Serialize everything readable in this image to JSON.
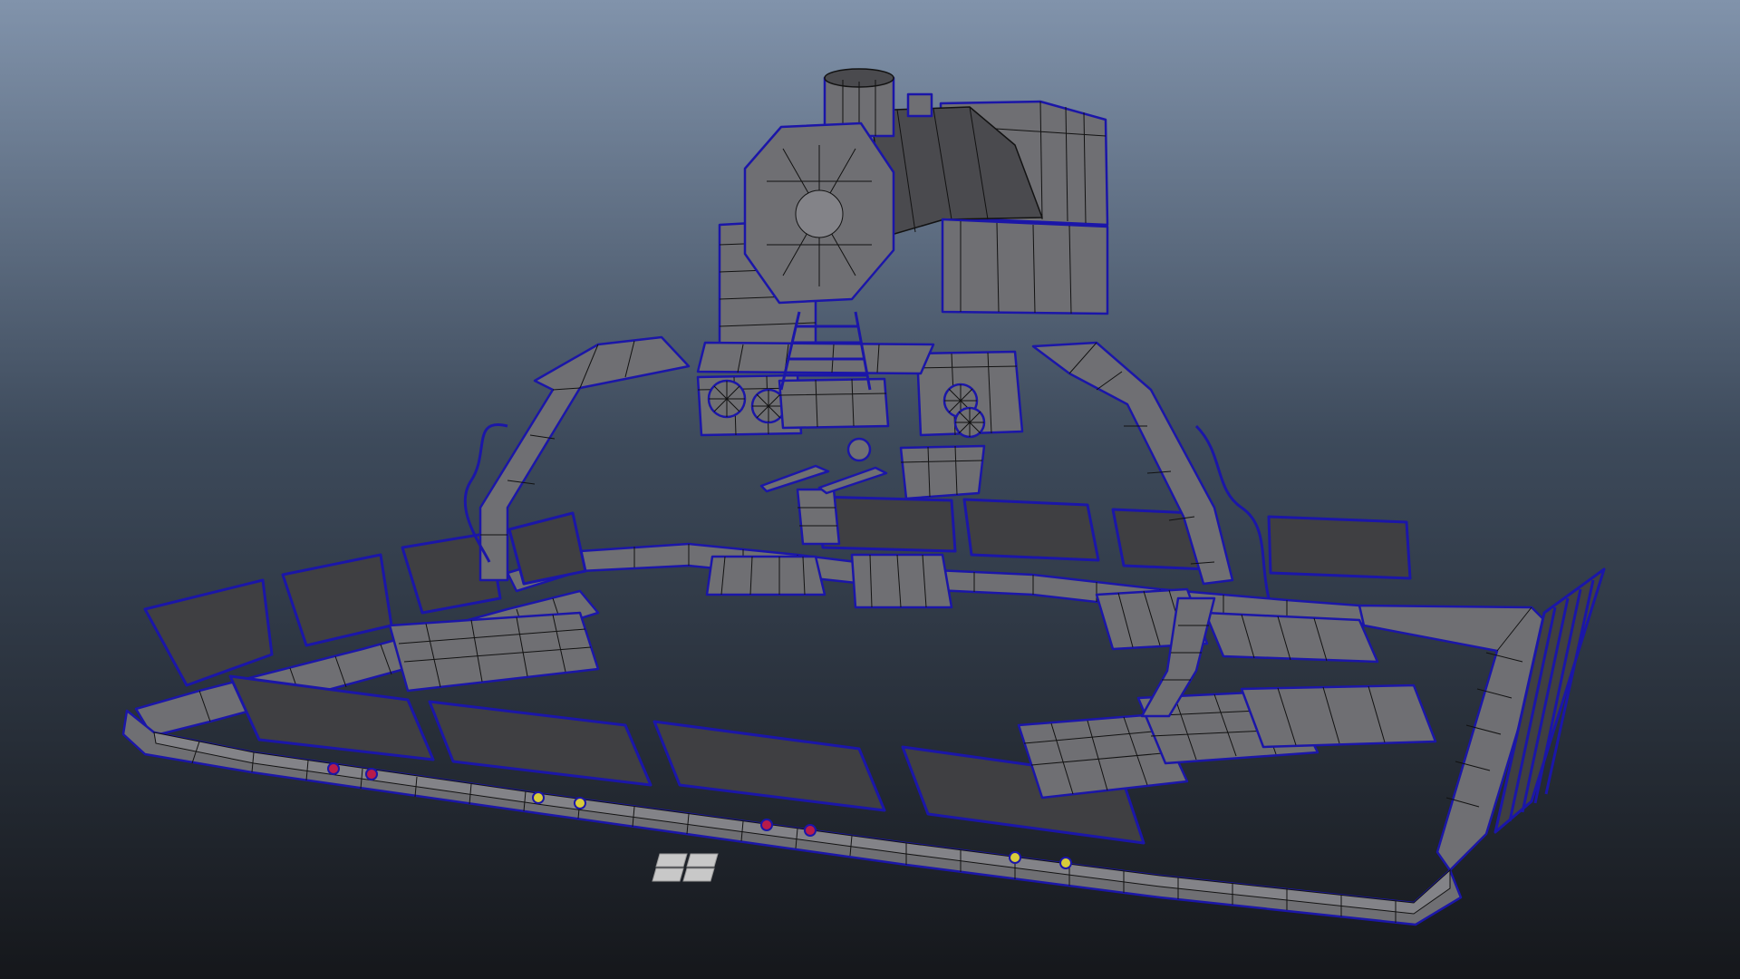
{
  "viewport": {
    "background_top": "#8193ab",
    "background_mid": "#3d4a5b",
    "background_bottom": "#15171b"
  },
  "model": {
    "shading": "wireframe-on-shaded",
    "selection_state": "selected",
    "surface_color": "#6f6f73",
    "surface_light": "#838388",
    "surface_dark": "#4a4a4e",
    "panel_color": "#3f3f42",
    "wire_color": "#121212",
    "selection_wire_color": "#1b16a8",
    "light_red": "#b81b4a",
    "light_yellow": "#d8cc3a"
  },
  "ground_grid": {
    "color": "#c8c8c8"
  }
}
